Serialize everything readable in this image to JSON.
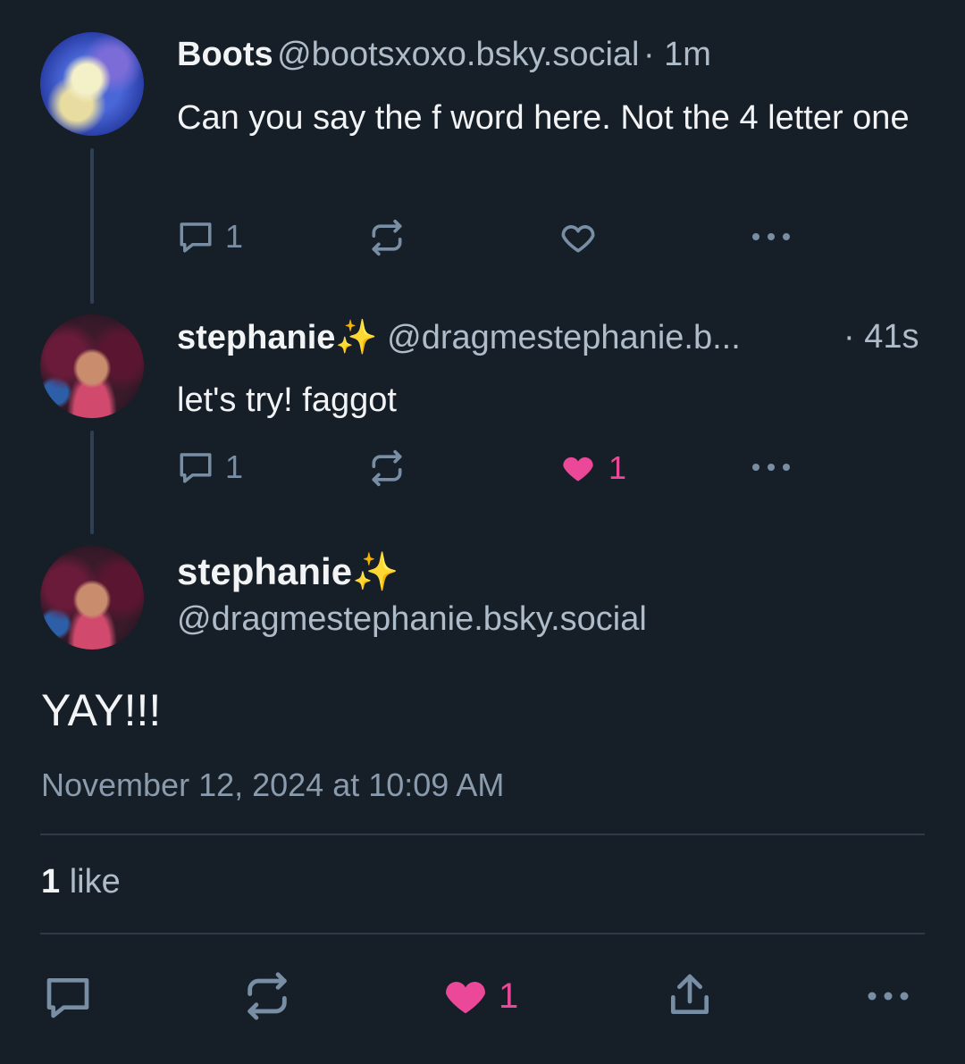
{
  "posts": [
    {
      "author_name": "Boots",
      "author_handle": "@bootsxoxo.bsky.social",
      "age": "· 1m",
      "text": "Can you say the f word here. Not the 4 letter one",
      "reply_count": "1",
      "like_count": "",
      "liked": false
    },
    {
      "author_name": "stephanie",
      "author_emoji": "✨",
      "author_handle": "@dragmestephanie.b...",
      "age": "· 41s",
      "text": "let's try! faggot",
      "reply_count": "1",
      "like_count": "1",
      "liked": true
    }
  ],
  "focused": {
    "author_name": "stephanie",
    "author_emoji": "✨",
    "author_handle": "@dragmestephanie.bsky.social",
    "text": "YAY!!!",
    "timestamp": "November 12, 2024 at 10:09 AM",
    "likes_number": "1",
    "likes_label": "like",
    "like_count": "1",
    "liked": true
  },
  "colors": {
    "background": "#161e27",
    "accent_like": "#ec4899",
    "muted": "#788ea5"
  },
  "icons": {
    "reply": "speech-bubble-icon",
    "repost": "repost-arrows-icon",
    "like": "heart-icon",
    "more": "ellipsis-icon",
    "share": "share-icon"
  }
}
